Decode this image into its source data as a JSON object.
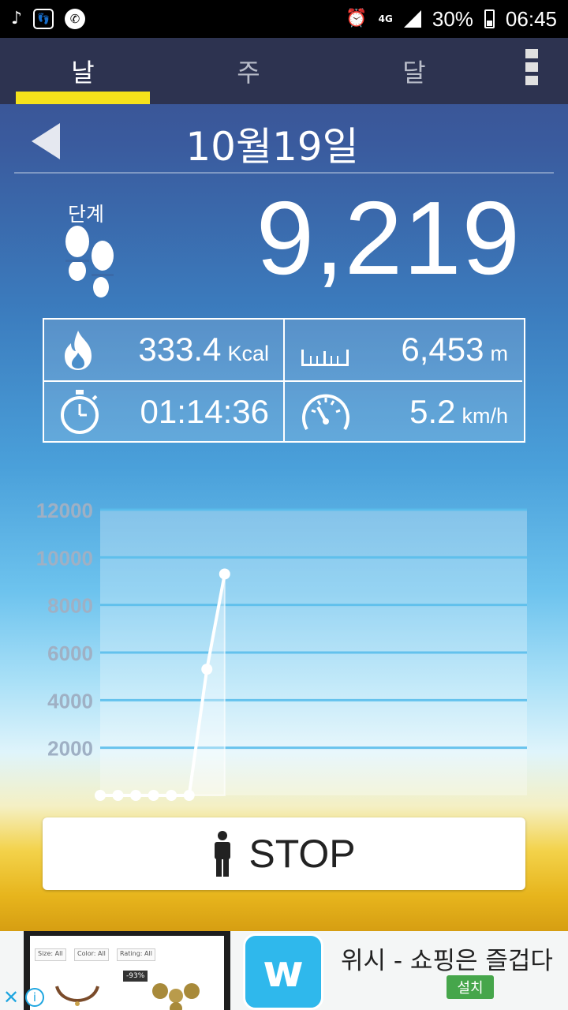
{
  "status_bar": {
    "left_icons": [
      "music-note-icon",
      "footprint-notification-icon",
      "phone-icon"
    ],
    "alarm_icon": "alarm-icon",
    "network": "4G",
    "battery_percent": "30%",
    "time": "06:45"
  },
  "tabs": [
    {
      "label": "날",
      "active": true
    },
    {
      "label": "주",
      "active": false
    },
    {
      "label": "달",
      "active": false
    }
  ],
  "date_title": "10월19일",
  "steps": {
    "label": "단계",
    "value": "9,219"
  },
  "stats": {
    "calories": {
      "value": "333.4",
      "unit": "Kcal",
      "icon": "flame-icon"
    },
    "distance": {
      "value": "6,453",
      "unit": "m",
      "icon": "ruler-icon"
    },
    "duration": {
      "value": "01:14:36",
      "icon": "stopwatch-icon"
    },
    "speed": {
      "value": "5.2",
      "unit": "km/h",
      "icon": "speedometer-icon"
    }
  },
  "chart_data": {
    "type": "line",
    "x": [
      0,
      1,
      2,
      3,
      4,
      5,
      6,
      7
    ],
    "values": [
      0,
      0,
      0,
      0,
      0,
      0,
      5300,
      9300
    ],
    "xlim": [
      0,
      24
    ],
    "ylim": [
      0,
      12000
    ],
    "y_ticks": [
      2000,
      4000,
      6000,
      8000,
      10000,
      12000
    ],
    "x_ticks": [
      2,
      4,
      6,
      8,
      10,
      12,
      14,
      16,
      18,
      20,
      22,
      24
    ],
    "grid": true
  },
  "stop_button": {
    "label": "STOP",
    "icon": "person-icon"
  },
  "ad": {
    "title": "위시 - 쇼핑은 즐겁다",
    "install_label": "설치",
    "logo_letter": "w",
    "chips": [
      "Size: All",
      "Color: All",
      "Rating: All"
    ],
    "discount_badge": "-93%"
  },
  "colors": {
    "tab_bar": "#2d3350",
    "tab_indicator": "#f5e21b",
    "chart_line": "#ffffff",
    "install_button": "#46a64b",
    "ad_logo": "#2fb8ec"
  }
}
